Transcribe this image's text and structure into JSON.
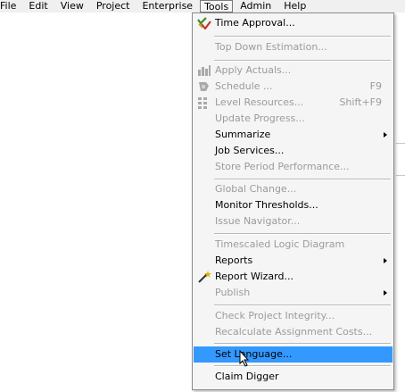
{
  "menubar": {
    "items": [
      {
        "label": "File"
      },
      {
        "label": "Edit"
      },
      {
        "label": "View"
      },
      {
        "label": "Project"
      },
      {
        "label": "Enterprise"
      },
      {
        "label": "Tools"
      },
      {
        "label": "Admin"
      },
      {
        "label": "Help"
      }
    ],
    "active": "Tools"
  },
  "tools_menu": {
    "items": [
      {
        "label": "Time Approval...",
        "enabled": true,
        "icon": "time-approval-check-icon"
      },
      {
        "label": "Top Down Estimation...",
        "enabled": false
      },
      {
        "label": "Apply Actuals...",
        "enabled": false,
        "icon": "apply-actuals-icon"
      },
      {
        "label": "Schedule ...",
        "enabled": false,
        "shortcut": "F9",
        "icon": "schedule-icon"
      },
      {
        "label": "Level Resources...",
        "enabled": false,
        "shortcut": "Shift+F9",
        "icon": "level-resources-icon"
      },
      {
        "label": "Update Progress...",
        "enabled": false
      },
      {
        "label": "Summarize",
        "enabled": true,
        "submenu": true
      },
      {
        "label": "Job Services...",
        "enabled": true
      },
      {
        "label": "Store Period Performance...",
        "enabled": false
      },
      {
        "label": "Global Change...",
        "enabled": false
      },
      {
        "label": "Monitor Thresholds...",
        "enabled": true
      },
      {
        "label": "Issue Navigator...",
        "enabled": false
      },
      {
        "label": "Timescaled Logic Diagram",
        "enabled": false
      },
      {
        "label": "Reports",
        "enabled": true,
        "submenu": true
      },
      {
        "label": "Report Wizard...",
        "enabled": true,
        "icon": "report-wizard-wand-icon"
      },
      {
        "label": "Publish",
        "enabled": false,
        "submenu": true
      },
      {
        "label": "Check Project Integrity...",
        "enabled": false
      },
      {
        "label": "Recalculate Assignment Costs...",
        "enabled": false
      },
      {
        "label": "Set Language...",
        "enabled": true,
        "highlighted": true
      },
      {
        "label": "Claim Digger",
        "enabled": true
      }
    ]
  },
  "colors": {
    "menu_background": "#f5f5f5",
    "highlight": "#3399ff",
    "disabled_text": "#9b9b9b"
  }
}
